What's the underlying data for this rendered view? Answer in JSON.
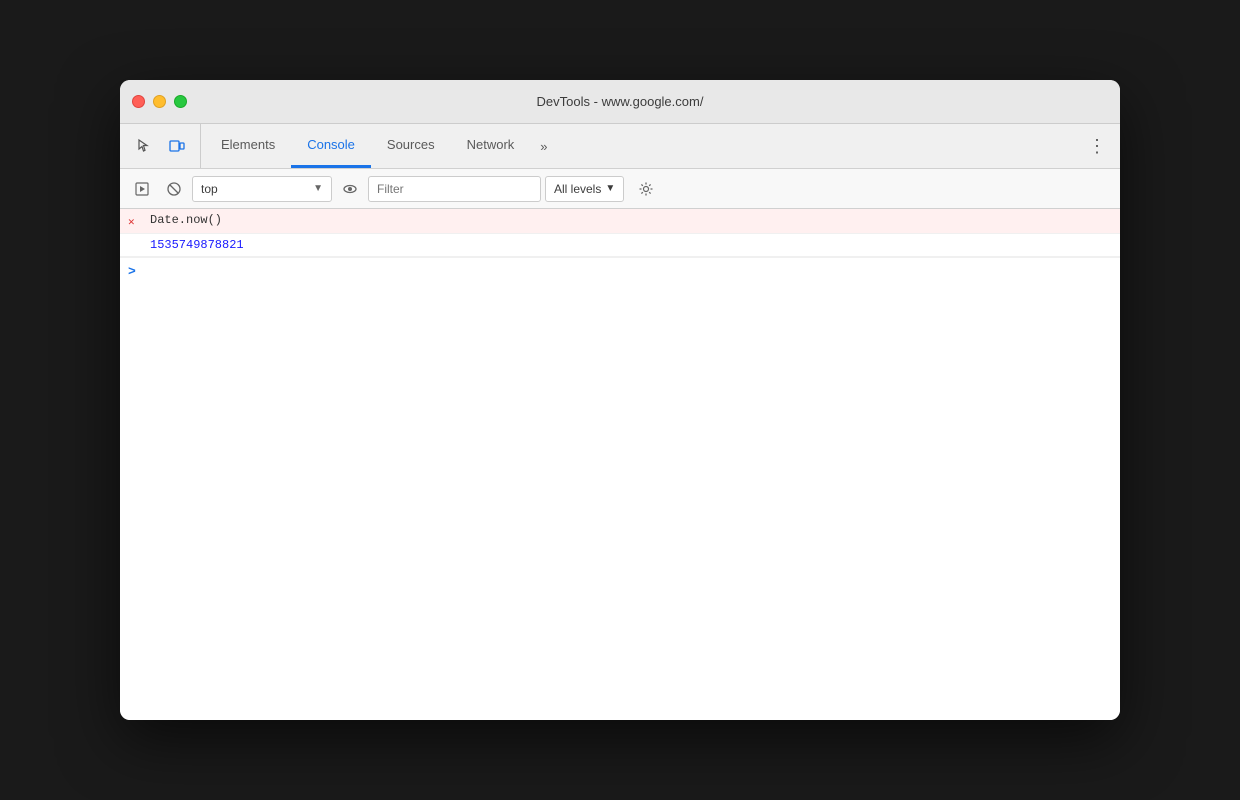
{
  "window": {
    "title": "DevTools - www.google.com/"
  },
  "tabs": {
    "items": [
      {
        "id": "elements",
        "label": "Elements",
        "active": false
      },
      {
        "id": "console",
        "label": "Console",
        "active": true
      },
      {
        "id": "sources",
        "label": "Sources",
        "active": false
      },
      {
        "id": "network",
        "label": "Network",
        "active": false
      }
    ],
    "more_label": "»"
  },
  "toolbar": {
    "context_value": "top",
    "filter_placeholder": "Filter",
    "levels_label": "All levels"
  },
  "console": {
    "entry_command": "Date.now()",
    "entry_result": "1535749878821",
    "prompt_symbol": ">"
  }
}
